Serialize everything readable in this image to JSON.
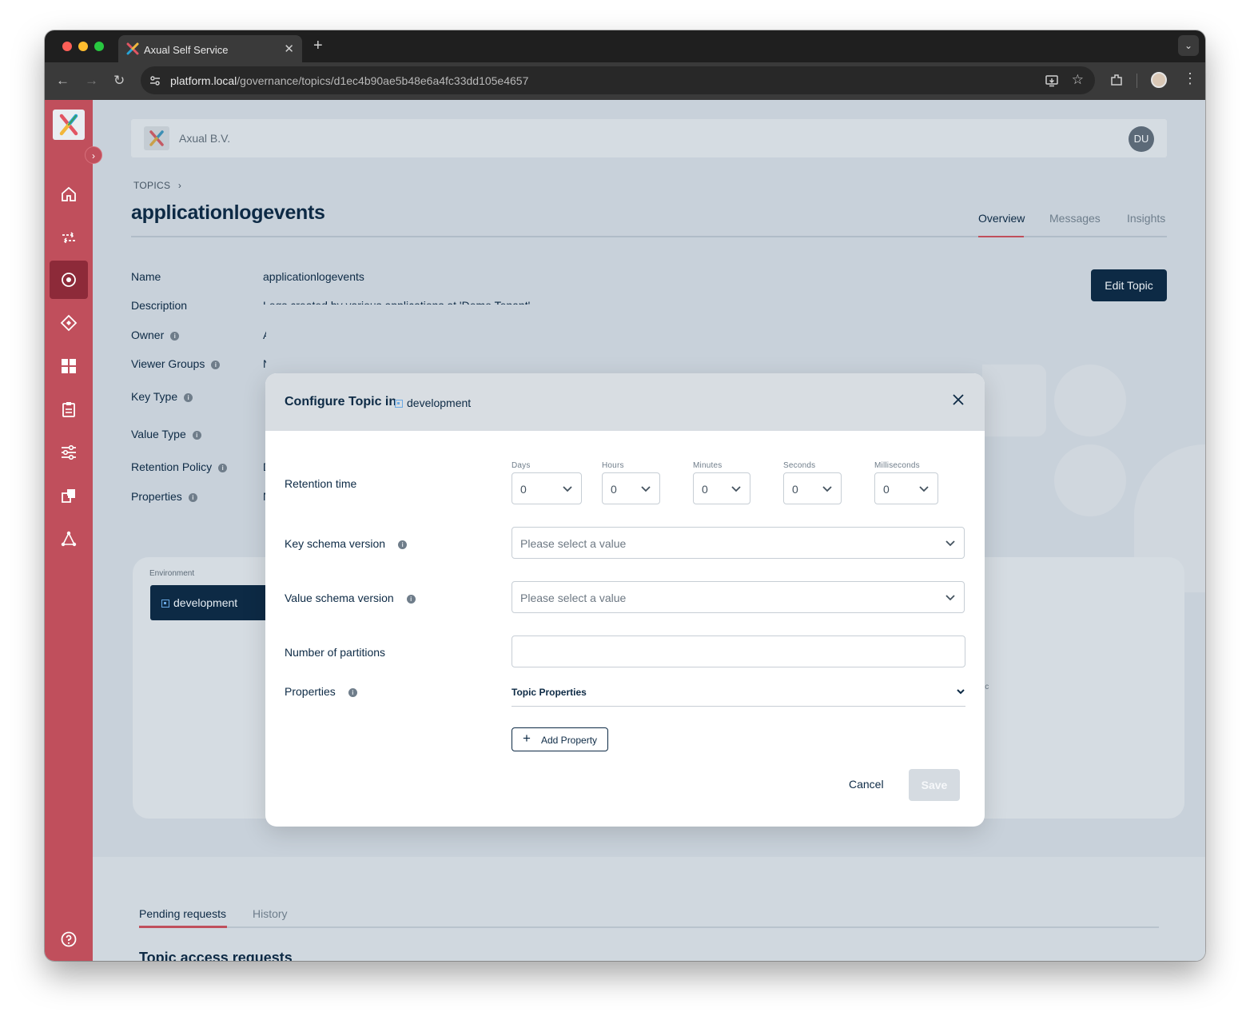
{
  "browser": {
    "tab_title": "Axual Self Service",
    "url_host": "platform.local",
    "url_path": "/governance/topics/d1ec4b90ae5b48e6a4fc33dd105e4657",
    "new_tab": "+",
    "tab_close": "✕"
  },
  "org": {
    "name": "Axual B.V.",
    "user_initials": "DU"
  },
  "breadcrumb": {
    "label": "TOPICS",
    "separator": "›"
  },
  "page": {
    "title": "applicationlogevents",
    "tabs": [
      {
        "label": "Overview",
        "active": true
      },
      {
        "label": "Messages",
        "active": false
      },
      {
        "label": "Insights",
        "active": false
      }
    ],
    "edit_button": "Edit Topic"
  },
  "properties": {
    "labels": [
      "Name",
      "Description",
      "Owner",
      "Viewer Groups",
      "Key Type",
      "Value Type",
      "Retention Policy",
      "Properties"
    ],
    "name_value": "applicationlogevents",
    "description_value": "Logs created by various applications at 'Demo Tenant'",
    "partial_values": [
      "A",
      "N",
      "D",
      "N"
    ]
  },
  "environment": {
    "label": "Environment",
    "selected": "development",
    "partial_text": "ic"
  },
  "bottom": {
    "tabs": [
      {
        "label": "Pending requests",
        "active": true
      },
      {
        "label": "History",
        "active": false
      }
    ],
    "section_title": "Topic access requests"
  },
  "modal": {
    "title": "Configure Topic in",
    "environment": "development",
    "retention": {
      "label": "Retention time",
      "units": [
        {
          "label": "Days",
          "value": "0"
        },
        {
          "label": "Hours",
          "value": "0"
        },
        {
          "label": "Minutes",
          "value": "0"
        },
        {
          "label": "Seconds",
          "value": "0"
        },
        {
          "label": "Milliseconds",
          "value": "0"
        }
      ]
    },
    "key_schema": {
      "label": "Key schema version",
      "placeholder": "Please select a value"
    },
    "value_schema": {
      "label": "Value schema version",
      "placeholder": "Please select a value"
    },
    "partitions": {
      "label": "Number of partitions",
      "value": ""
    },
    "properties": {
      "label": "Properties",
      "section": "Topic Properties",
      "add_button": "Add Property",
      "add_symbol": "+"
    },
    "cancel": "Cancel",
    "save": "Save"
  },
  "colors": {
    "sidebar": "#c04f5c",
    "primary": "#0d2a45",
    "accent": "#c04f5c"
  },
  "icons": [
    "home-icon",
    "streams-icon",
    "topics-icon",
    "schemas-icon",
    "applications-icon",
    "clipboard-icon",
    "settings-icon",
    "environments-icon",
    "network-icon",
    "help-icon"
  ]
}
